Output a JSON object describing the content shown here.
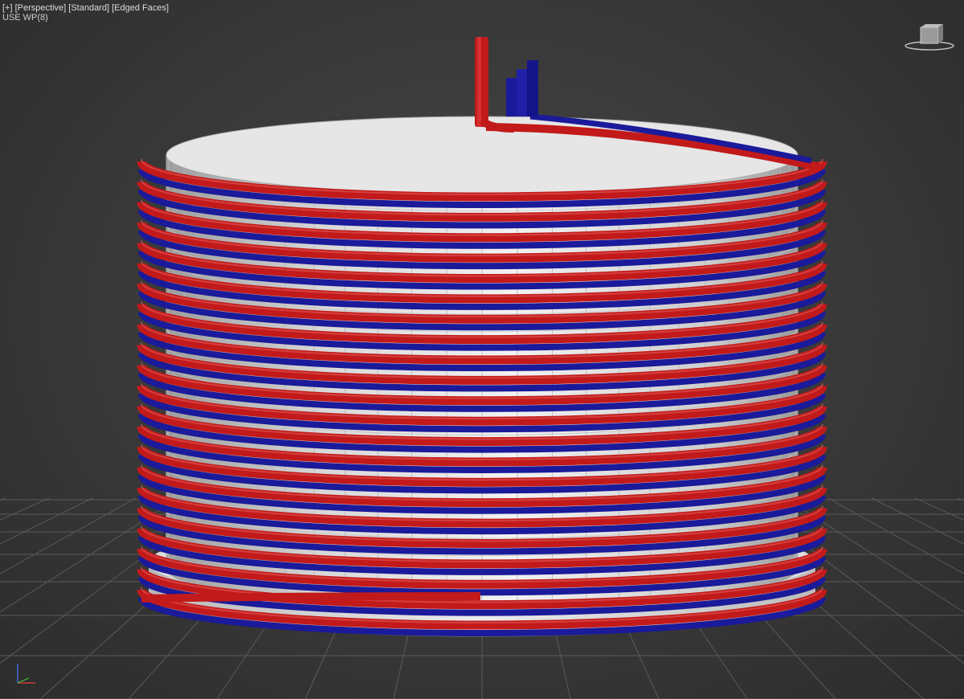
{
  "viewport": {
    "menu": {
      "plus": "[+]",
      "view": "[Perspective]",
      "shading": "[Standard]",
      "edges": "[Edged Faces]"
    },
    "status": "USE WP(8)"
  },
  "colors": {
    "background": "#3a3a3a",
    "grid": "#5a5a5a",
    "pipe_red": "#c21a1a",
    "pipe_blue": "#1a1a9a",
    "cylinder": "#d9d9d9"
  },
  "scene": {
    "object": "coil-cylinder",
    "coil_turns": 22,
    "pipes": [
      "red",
      "blue"
    ]
  },
  "widgets": {
    "viewcube": "viewcube-icon",
    "axis": "axis-tripod-icon"
  }
}
